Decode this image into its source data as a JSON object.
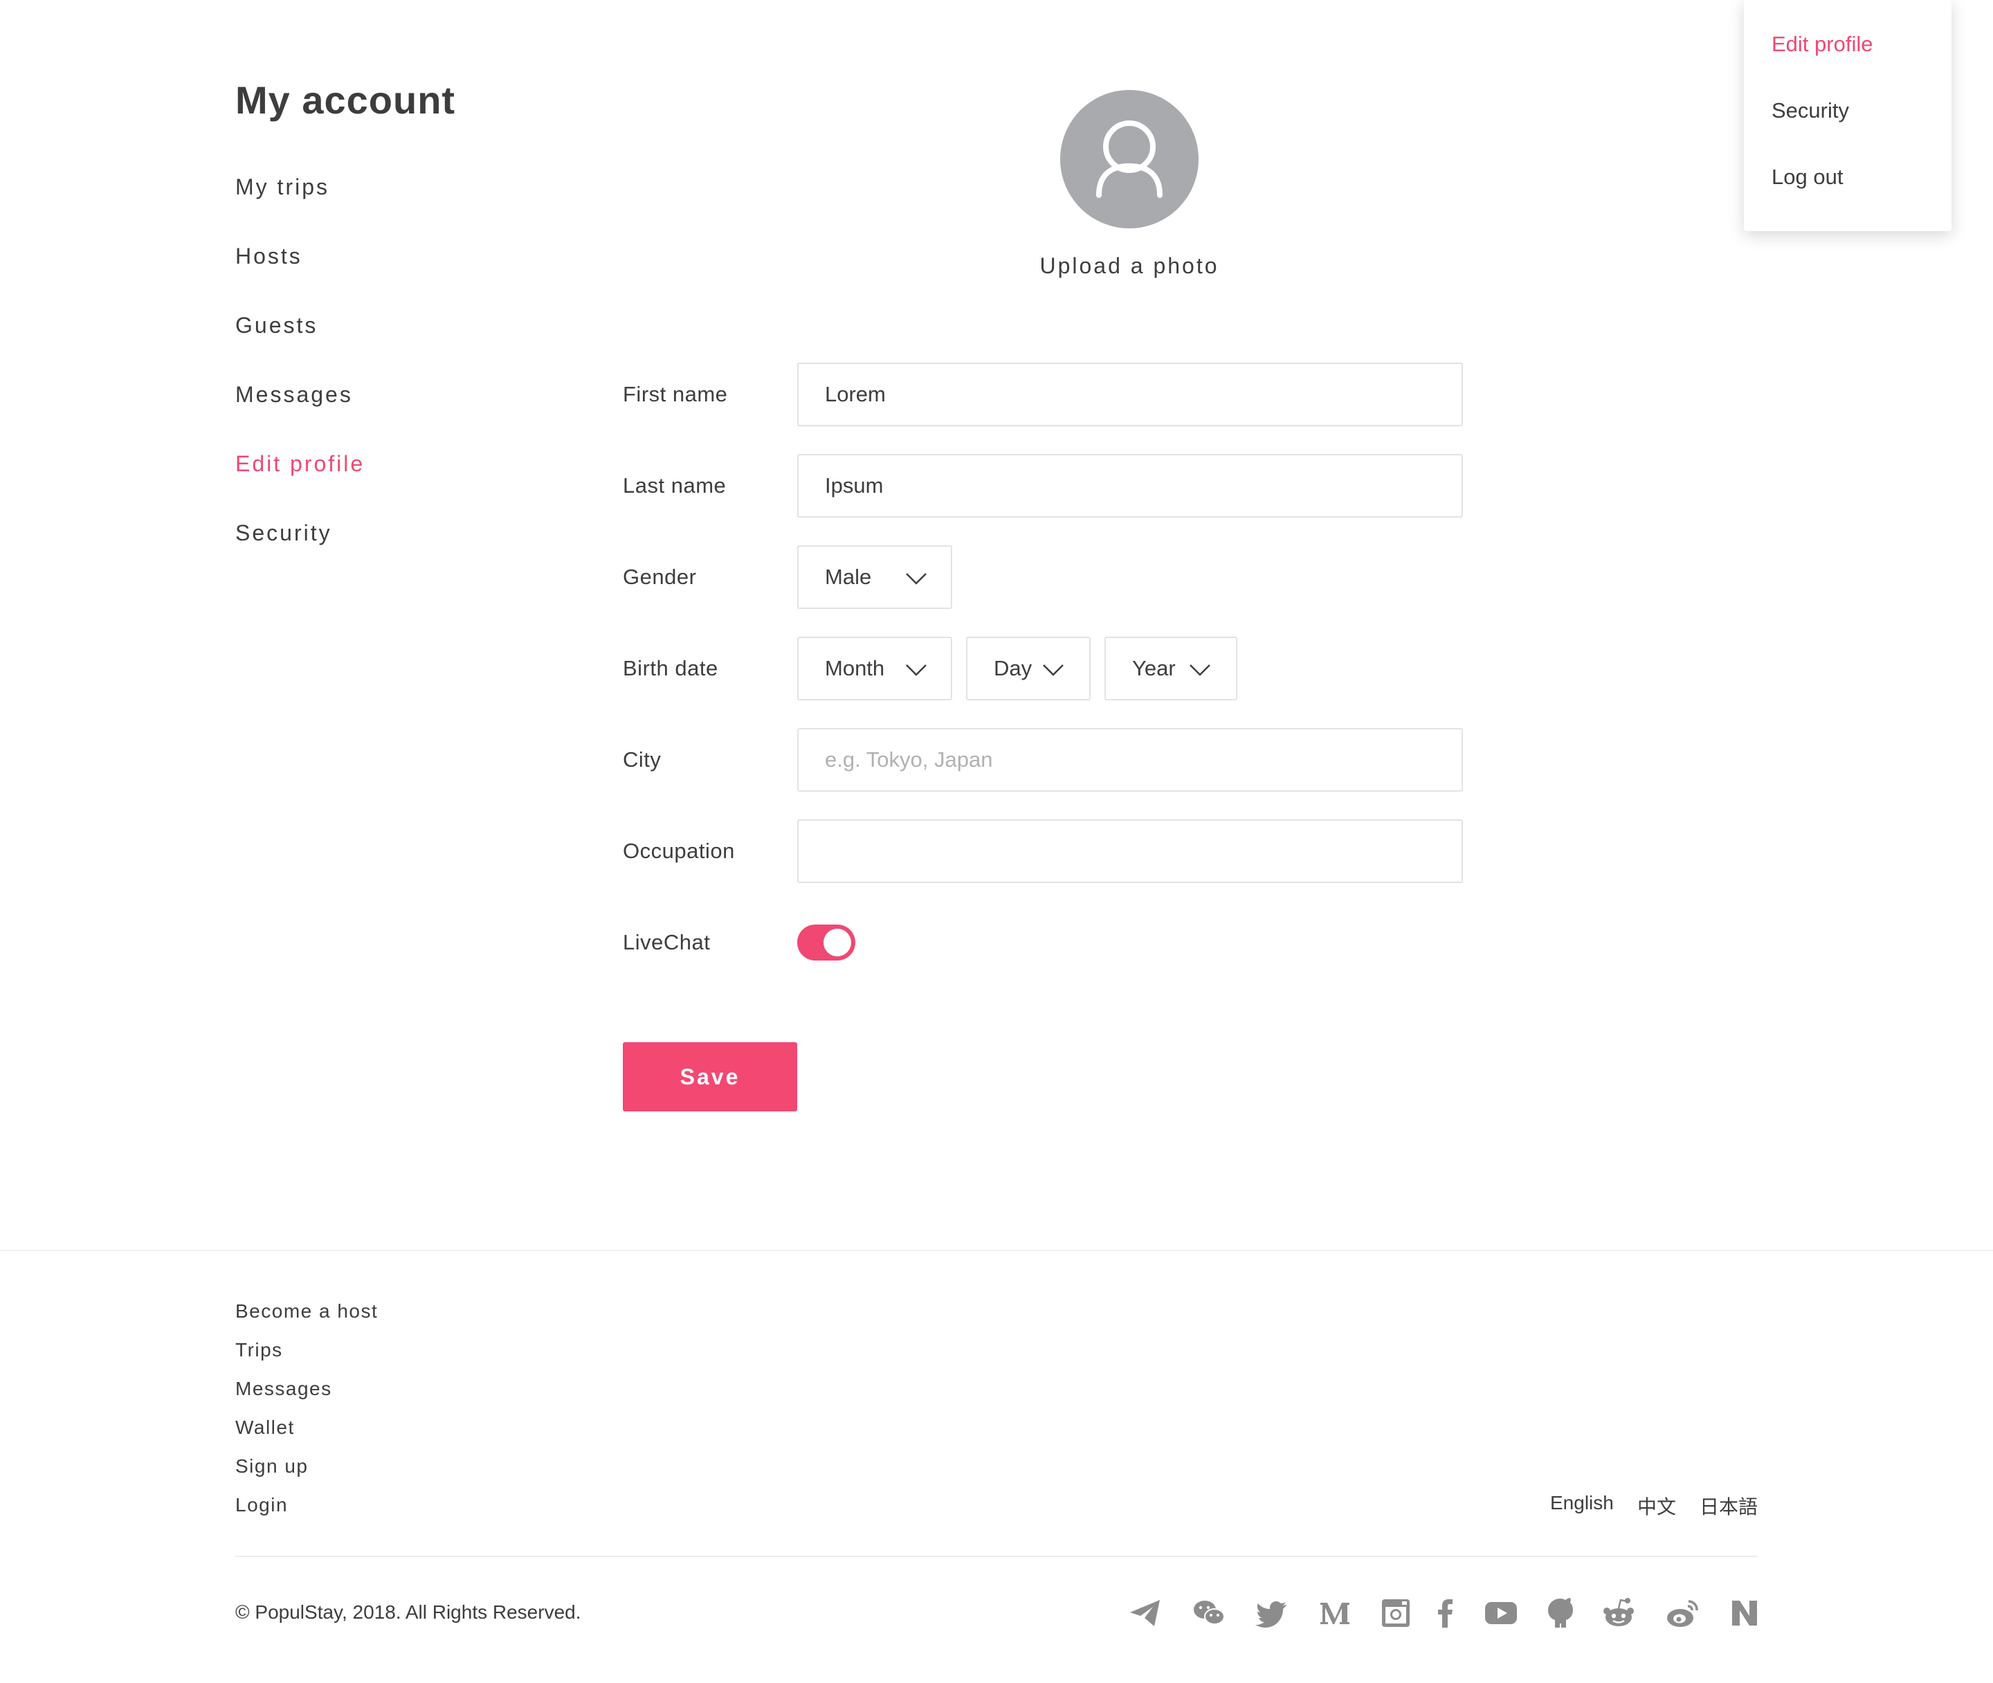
{
  "sidebar": {
    "title": "My account",
    "items": [
      {
        "label": "My trips",
        "active": false
      },
      {
        "label": "Hosts",
        "active": false
      },
      {
        "label": "Guests",
        "active": false
      },
      {
        "label": "Messages",
        "active": false
      },
      {
        "label": "Edit profile",
        "active": true
      },
      {
        "label": "Security",
        "active": false
      }
    ]
  },
  "profile": {
    "avatar_icon": "user-icon",
    "upload_label": "Upload a photo"
  },
  "form": {
    "first_name": {
      "label": "First name",
      "value": "Lorem"
    },
    "last_name": {
      "label": "Last name",
      "value": "Ipsum"
    },
    "gender": {
      "label": "Gender",
      "value": "Male"
    },
    "birth_date": {
      "label": "Birth date",
      "month": "Month",
      "day": "Day",
      "year": "Year"
    },
    "city": {
      "label": "City",
      "value": "",
      "placeholder": "e.g. Tokyo, Japan"
    },
    "occupation": {
      "label": "Occupation",
      "value": ""
    },
    "livechat": {
      "label": "LiveChat",
      "enabled": true
    },
    "save_label": "Save"
  },
  "dropdown": {
    "items": [
      {
        "label": "Edit profile",
        "active": true
      },
      {
        "label": "Security",
        "active": false
      },
      {
        "label": "Log out",
        "active": false
      }
    ]
  },
  "footer": {
    "links": [
      "Become a host",
      "Trips",
      "Messages",
      "Wallet",
      "Sign up",
      "Login"
    ],
    "languages": [
      "English",
      "中文",
      "日本語"
    ],
    "copyright": "© PopulStay, 2018. All Rights Reserved.",
    "social": [
      "telegram-icon",
      "wechat-icon",
      "twitter-icon",
      "medium-icon",
      "instagram-icon",
      "facebook-icon",
      "youtube-icon",
      "github-icon",
      "reddit-icon",
      "weibo-icon",
      "n-icon"
    ]
  },
  "colors": {
    "accent": "#f04872",
    "text": "#3d3d3d",
    "muted_icon": "#8c8c8c",
    "avatar_bg": "#a9aaad"
  }
}
